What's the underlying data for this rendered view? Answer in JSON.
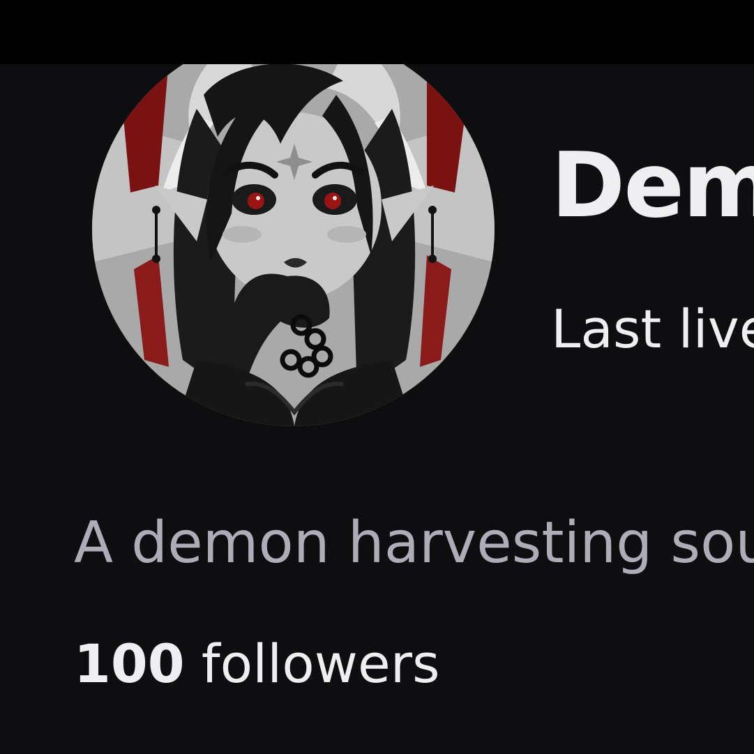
{
  "profile": {
    "display_name": "Dem",
    "last_live": "Last live",
    "bio": "A demon harvesting sou",
    "followers_count": "100",
    "followers_label": " followers",
    "avatar_icon": "avatar-demon-character"
  },
  "colors": {
    "background": "#0e0e10",
    "top_bar": "#000000",
    "primary_text": "#efeff1",
    "secondary_text": "#adadb8",
    "accent_red": "#8b1a1a"
  }
}
